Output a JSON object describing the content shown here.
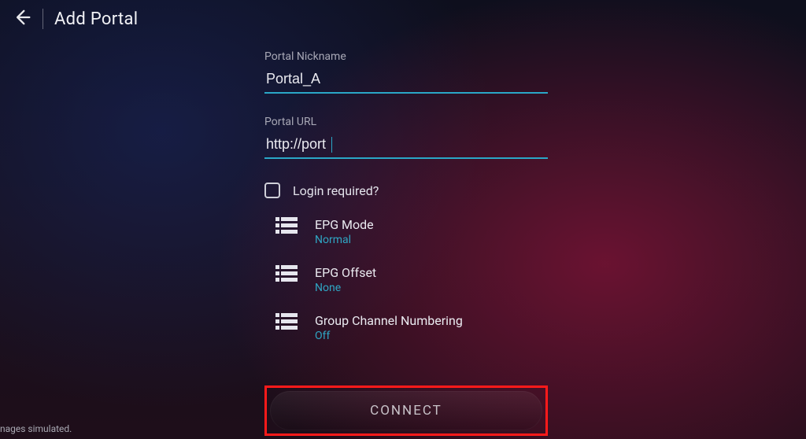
{
  "header": {
    "title": "Add Portal"
  },
  "fields": {
    "nickname": {
      "label": "Portal Nickname",
      "value": "Portal_A"
    },
    "url": {
      "label": "Portal URL",
      "value": "http://port"
    }
  },
  "login": {
    "label": "Login required?",
    "checked": false
  },
  "options": {
    "epg_mode": {
      "title": "EPG Mode",
      "value": "Normal"
    },
    "epg_offset": {
      "title": "EPG Offset",
      "value": "None"
    },
    "group_num": {
      "title": "Group Channel Numbering",
      "value": "Off"
    }
  },
  "connect": {
    "label": "CONNECT"
  },
  "footer": {
    "note": "nages simulated."
  },
  "colors": {
    "accent": "#2aa7c7",
    "highlight_box": "#ff1a1a"
  }
}
